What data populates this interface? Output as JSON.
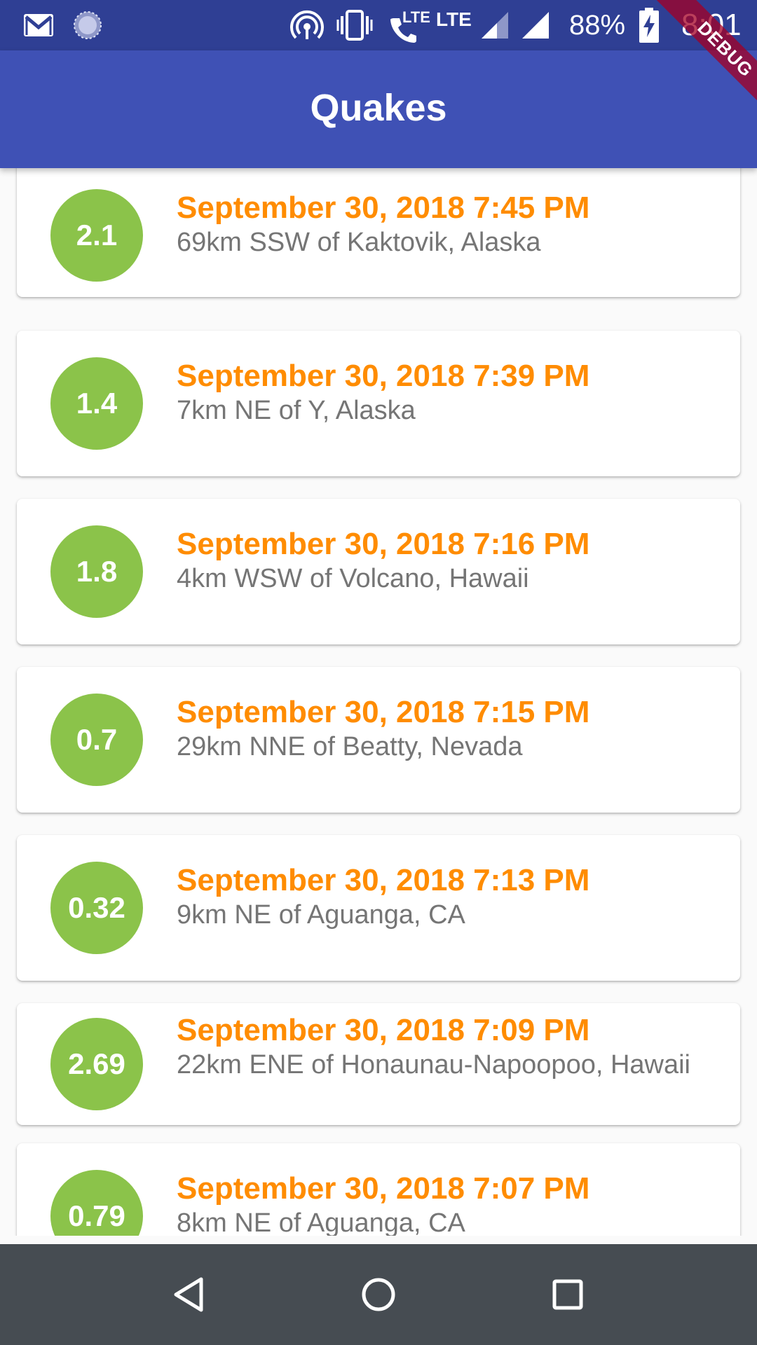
{
  "status_bar": {
    "battery_percent": "88%",
    "time": "8:01",
    "lte_small": "LTE",
    "lte_label": "LTE",
    "icons": [
      "gmail-icon",
      "sync-icon",
      "hotspot-icon",
      "vibrate-icon",
      "volte-call-icon",
      "signal-icon",
      "signal-icon",
      "battery-charging-icon"
    ]
  },
  "app_bar": {
    "title": "Quakes",
    "debug_label": "DEBUG"
  },
  "colors": {
    "primary": "#3f51b5",
    "status_bar": "#2f3f94",
    "accent_date": "#ff8c00",
    "magnitude_circle": "#8bc34a",
    "place_text": "#757575",
    "nav_bar": "#464c52"
  },
  "quakes": [
    {
      "magnitude": "2.1",
      "date": "September 30, 2018 7:45 PM",
      "place": "69km SSW of Kaktovik, Alaska"
    },
    {
      "magnitude": "1.4",
      "date": "September 30, 2018 7:39 PM",
      "place": "7km NE of Y, Alaska"
    },
    {
      "magnitude": "1.8",
      "date": "September 30, 2018 7:16 PM",
      "place": "4km WSW of Volcano, Hawaii"
    },
    {
      "magnitude": "0.7",
      "date": "September 30, 2018 7:15 PM",
      "place": "29km NNE of Beatty, Nevada"
    },
    {
      "magnitude": "0.32",
      "date": "September 30, 2018 7:13 PM",
      "place": "9km NE of Aguanga, CA"
    },
    {
      "magnitude": "2.69",
      "date": "September 30, 2018 7:09 PM",
      "place": "22km ENE of Honaunau-Napoopoo, Hawaii"
    },
    {
      "magnitude": "0.79",
      "date": "September 30, 2018 7:07 PM",
      "place": "8km NE of Aguanga, CA"
    }
  ],
  "nav_bar": {
    "icons": [
      "back-icon",
      "home-icon",
      "recents-icon"
    ]
  }
}
